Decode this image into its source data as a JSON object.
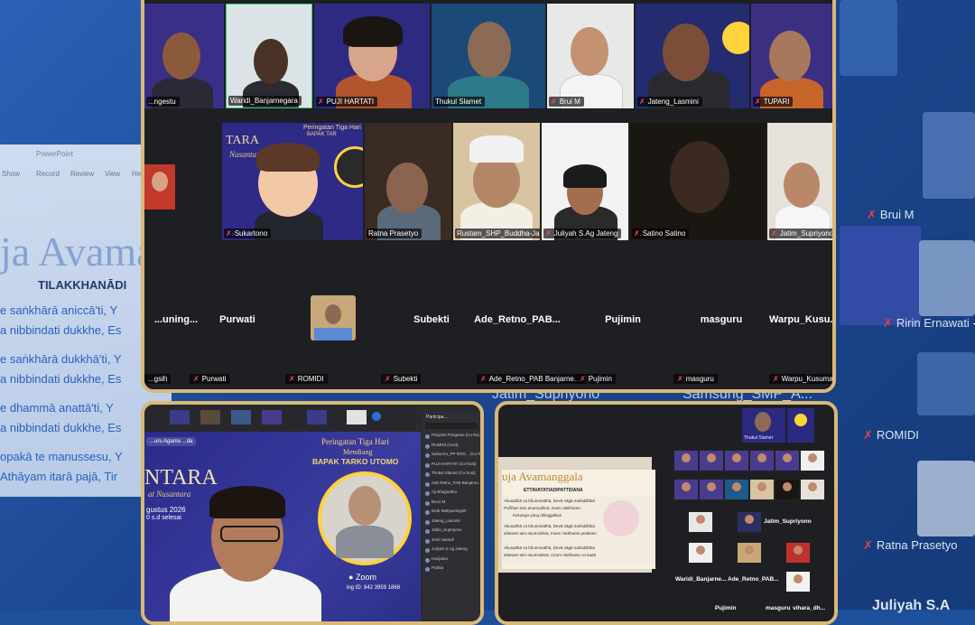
{
  "background": {
    "ppt_app": "PowerPoint",
    "ppt_menu": [
      "Show",
      "Record",
      "Review",
      "View",
      "He"
    ],
    "slide_title": "ja Avamang",
    "slide_heading": "TILAKKHANĀDI",
    "slide_lines": [
      "e saṅkhārā aniccā'ti, Y",
      "a nibbindati dukkhe, Es",
      "e saṅkhārā dukkhā'ti, Y",
      "a nibbindati dukkhe, Es",
      "e dhammā anattā'ti, Y",
      "a nibbindati dukkhe, Es",
      "opakā te manussesu, Y",
      "Athāyam itarā pajā, Tir"
    ],
    "right_names": [
      "Brui M",
      "Ririn Ernawati - L",
      "ROMIDI",
      "Ratna Prasetyo",
      "Juliyah S.A"
    ],
    "lower_names": [
      "Jatim_Supriyono",
      "Samsung_SMP_A..."
    ]
  },
  "main_gallery": {
    "row1": [
      "...ngestu",
      "Waridi_Banjarnegara",
      "PUJI HARTATI",
      "Thukul Slamet",
      "Brui M",
      "Jateng_Lasmini",
      "TUPARI"
    ],
    "row2": [
      "",
      "Sukartono",
      "Ratna Prasetyo",
      "Rustam_SHP_Buddha-Ja...",
      "Juliyah S.Ag Jateng",
      "Satino Satino",
      "Jatim_Supriyono"
    ],
    "poster_words": {
      "brand": "TARA",
      "sub": "Nusantara",
      "ceremony": "Peringatan Tiga Hari",
      "mendiang": "BAPAK TAR"
    },
    "audio_big": [
      "...uning...",
      "Purwati",
      "",
      "Subekti",
      "Ade_Retno_PAB...",
      "Pujimin",
      "masguru",
      "Warpu_Kusu..."
    ],
    "audio_small": [
      "...gsih",
      "Purwati",
      "ROMIDI",
      "Subekti",
      "Ade_Retno_PAB Banjarne...",
      "Pujimin",
      "masguru",
      "Warpu_Kusuma"
    ]
  },
  "bottom_left": {
    "tag": "...uru Agama ...da",
    "ceremony_title": "Peringatan Tiga Hari",
    "mendiang": "Mendiang",
    "name": "BAPAK TARKO UTOMO",
    "brand": "NTARA",
    "brand_sub": "at Nusantara",
    "date": "gustus 2026",
    "time": "0 s.d selesai",
    "zoom_label": "Zoom",
    "meeting": "ing ID: 842 3959 1868",
    "participants_header": "Participa...",
    "participants": [
      "Pinpoint Pengestu (Co-ho)",
      "RUMINI (Host)",
      "Sukarmo_PP ROG... (Co-h)",
      "PUJI HARTATI (Co-host)",
      "Thukul Slamet (Co-host)",
      "Ade Retno_PAB Banjarne...",
      "Aji Bhagiratho",
      "Bruci M",
      "Dedi Wahyuningsih",
      "Jateng_Lasmini",
      "Jatim_Supriyono",
      "Jemi Harsidi",
      "Juliyah S.Ag Jateng",
      "Harijanto",
      "Purbia"
    ]
  },
  "bottom_right": {
    "slide_title": "uja Avamanggala",
    "slide_sub": "ETTAVATATIADIPATTIDANA",
    "slide_lines": [
      "Akusatthā ca bhummatthā, Devā nāgā mahiddhikā",
      "Puññam tam anumoditvā, Imam rakkhantu",
      "Keluarga yang ditinggalkan",
      "Akusatthā ca bhummatthā, Devā nāgā mahiddhikā",
      "ahānam tam anumoditvā, Imam rakkhantu petakam",
      "Akusatthā ca bhummatthā, Devā nāgā mahiddhikā",
      "ahānam tam anumoditvā, Ciram rakkhantu vo kadā"
    ],
    "top_label": "Thukul Slamet",
    "names": [
      "Jatim_Supriyono",
      "Waridi_Banjarne...",
      "Ade_Retno_PAB...",
      "Pujimin",
      "masguru",
      "vihara_dh..."
    ]
  }
}
